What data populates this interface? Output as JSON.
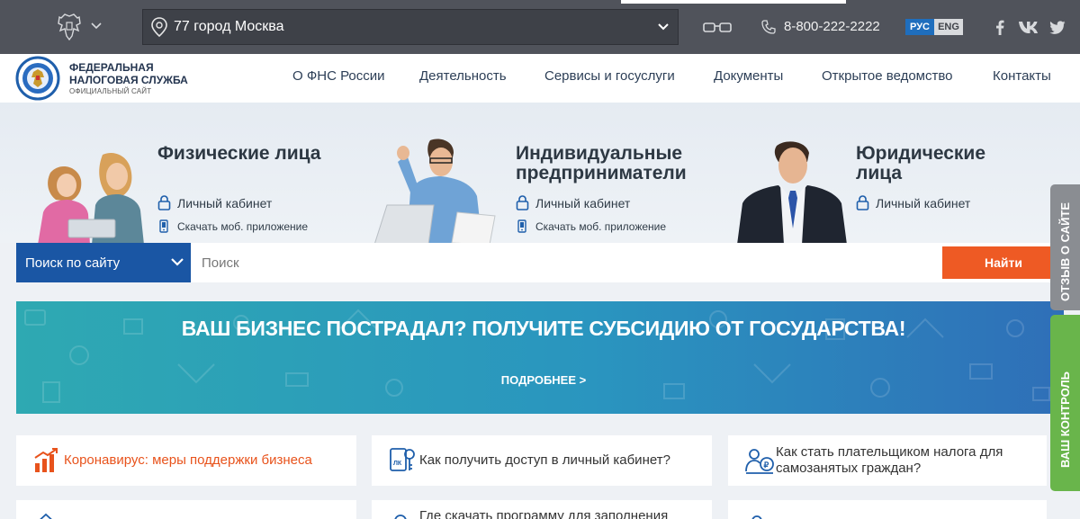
{
  "topbar": {
    "region": "77 город Москва",
    "phone": "8-800-222-2222",
    "lang_ru": "РУС",
    "lang_en": "ENG"
  },
  "header": {
    "org_name": "ФЕДЕРАЛЬНАЯ НАЛОГОВАЯ СЛУЖБА",
    "org_sub": "ОФИЦИАЛЬНЫЙ САЙТ",
    "nav": [
      "О ФНС России",
      "Деятельность",
      "Сервисы и госуслуги",
      "Документы",
      "Открытое ведомство",
      "Контакты"
    ]
  },
  "hero": {
    "individuals": {
      "title": "Физические лица",
      "cabinet": "Личный кабинет",
      "app": "Скачать моб. приложение"
    },
    "entrepreneurs": {
      "title": "Индивидуальные предприниматели",
      "cabinet": "Личный кабинет",
      "app": "Скачать моб. приложение"
    },
    "legal": {
      "title": "Юридические лица",
      "cabinet": "Личный кабинет"
    }
  },
  "search": {
    "scope": "Поиск по сайту",
    "placeholder": "Поиск",
    "button": "Найти"
  },
  "banner": {
    "title": "ВАШ БИЗНЕС ПОСТРАДАЛ? ПОЛУЧИТЕ СУБСИДИЮ ОТ ГОСУДАРСТВА!",
    "more": "ПОДРОБНЕЕ >"
  },
  "side_tabs": {
    "review": "ОТЗЫВ О САЙТЕ",
    "control": "ВАШ КОНТРОЛЬ"
  },
  "cards": [
    {
      "text": "Коронавирус: меры поддержки бизнеса",
      "color": "#e8531c"
    },
    {
      "text": "Как получить доступ в личный кабинет?",
      "color": "#333333"
    },
    {
      "text": "Как стать плательщиком налога для самозанятых граждан?",
      "color": "#333333"
    },
    {
      "text": "Где скачать программу для заполнения",
      "color": "#333333"
    }
  ],
  "colors": {
    "topbar": "#50535b",
    "accent_blue": "#1a56a4",
    "search_button": "#ee5a24",
    "review_tab": "#8a8d92",
    "control_tab": "#69b54b"
  }
}
